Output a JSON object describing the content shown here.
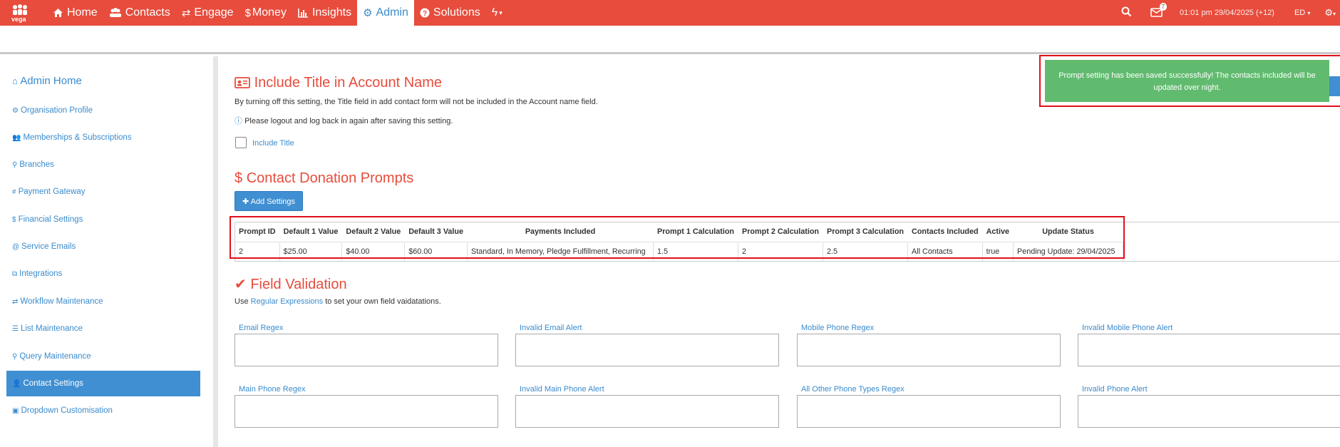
{
  "nav": {
    "logo_text": "vega",
    "items": [
      {
        "label": "Home",
        "icon": "home-icon"
      },
      {
        "label": "Contacts",
        "icon": "users-icon"
      },
      {
        "label": "Engage",
        "icon": "exchange-icon"
      },
      {
        "label": "Money",
        "icon": "dollar-icon"
      },
      {
        "label": "Insights",
        "icon": "bar-chart-icon"
      },
      {
        "label": "Admin",
        "icon": "cogs-icon"
      },
      {
        "label": "Solutions",
        "icon": "question-icon"
      }
    ],
    "mail_badge": "7",
    "clock": "01:01 pm 29/04/2025 (+12)",
    "user": "ED"
  },
  "sidebar": {
    "home": "Admin Home",
    "items": [
      "Organisation Profile",
      "Memberships & Subscriptions",
      "Branches",
      "Payment Gateway",
      "Financial Settings",
      "Service Emails",
      "Integrations",
      "Workflow Maintenance",
      "List Maintenance",
      "Query Maintenance",
      "Contact Settings",
      "Dropdown Customisation"
    ]
  },
  "title_section": {
    "heading": "Include Title in Account Name",
    "desc": "By turning off this setting, the Title field in add contact form will not be included in the Account name field.",
    "info": "Please logout and log back in again after saving this setting.",
    "checkbox_label": "Include Title"
  },
  "prompts": {
    "heading": "Contact Donation Prompts",
    "add_button": "Add Settings",
    "columns": [
      "Prompt ID",
      "Default 1 Value",
      "Default 2 Value",
      "Default 3 Value",
      "Payments Included",
      "Prompt 1 Calculation",
      "Prompt 2 Calculation",
      "Prompt 3 Calculation",
      "Contacts Included",
      "Active",
      "Update Status"
    ],
    "rows": [
      [
        "2",
        "$25.00",
        "$40.00",
        "$60.00",
        "Standard, In Memory, Pledge Fulfillment, Recurring",
        "1.5",
        "2",
        "2.5",
        "All Contacts",
        "true",
        "Pending Update: 29/04/2025"
      ]
    ]
  },
  "toast": {
    "message": "Prompt setting has been saved successfully! The contacts included will be updated over night."
  },
  "validation": {
    "heading": "Field Validation",
    "desc_prefix": "Use",
    "desc_link": "Regular Expressions",
    "desc_suffix": "to set your own field vaidatations.",
    "fields_row1": [
      "Email Regex",
      "Invalid Email Alert",
      "Mobile Phone Regex",
      "Invalid Mobile Phone Alert"
    ],
    "fields_row2": [
      "Main Phone Regex",
      "Invalid Main Phone Alert",
      "All Other Phone Types Regex",
      "Invalid Phone Alert"
    ]
  },
  "colors": {
    "brand": "#e74c3c",
    "accent": "#3a8bcd",
    "success": "#61bb6f",
    "highlight": "#e0101a"
  }
}
